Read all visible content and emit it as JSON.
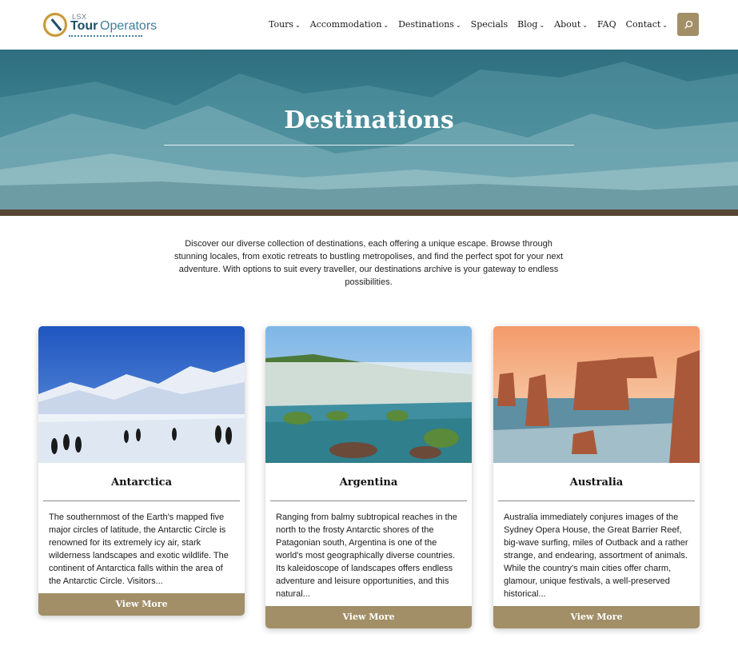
{
  "brand": {
    "logo_small": "LSX",
    "logo_tour": "Tour",
    "logo_operators": "Operators"
  },
  "nav": {
    "items": [
      {
        "label": "Tours",
        "has_dropdown": true
      },
      {
        "label": "Accommodation",
        "has_dropdown": true
      },
      {
        "label": "Destinations",
        "has_dropdown": true
      },
      {
        "label": "Specials",
        "has_dropdown": false
      },
      {
        "label": "Blog",
        "has_dropdown": true
      },
      {
        "label": "About",
        "has_dropdown": true
      },
      {
        "label": "FAQ",
        "has_dropdown": false
      },
      {
        "label": "Contact",
        "has_dropdown": true
      }
    ],
    "search_icon": "search-icon"
  },
  "hero": {
    "title": "Destinations"
  },
  "intro": {
    "text": "Discover our diverse collection of destinations, each offering a unique escape. Browse through stunning locales, from exotic retreats to bustling metropolises, and find the perfect spot for your next adventure. With options to suit every traveller, our destinations archive is your gateway to endless possibilities."
  },
  "cards": [
    {
      "title": "Antarctica",
      "text": "The southernmost of the Earth's mapped five major circles of latitude, the Antarctic Circle is renowned for its extremely icy air, stark wilderness landscapes and exotic wildlife. The continent of Antarctica falls within the area of the Antarctic Circle. Visitors...",
      "button": "View More"
    },
    {
      "title": "Argentina",
      "text": "Ranging from balmy subtropical reaches in the north to the frosty Antarctic shores of the Patagonian south, Argentina is one of the world's most geographically diverse countries. Its kaleidoscope of landscapes offers endless adventure and leisure opportunities, and this natural...",
      "button": "View More"
    },
    {
      "title": "Australia",
      "text": "Australia immediately conjures images of the Sydney Opera House, the Great Barrier Reef, big-wave surfing, miles of Outback and a rather strange, and endearing, assortment of animals. While the country's main cities offer charm, glamour, unique festivals, a well-preserved historical...",
      "button": "View More"
    }
  ],
  "colors": {
    "accent": "#a28f68",
    "hero_overlay": "#2f6e7e",
    "hero_strip": "#574535",
    "brand_dark": "#1c4e66"
  }
}
